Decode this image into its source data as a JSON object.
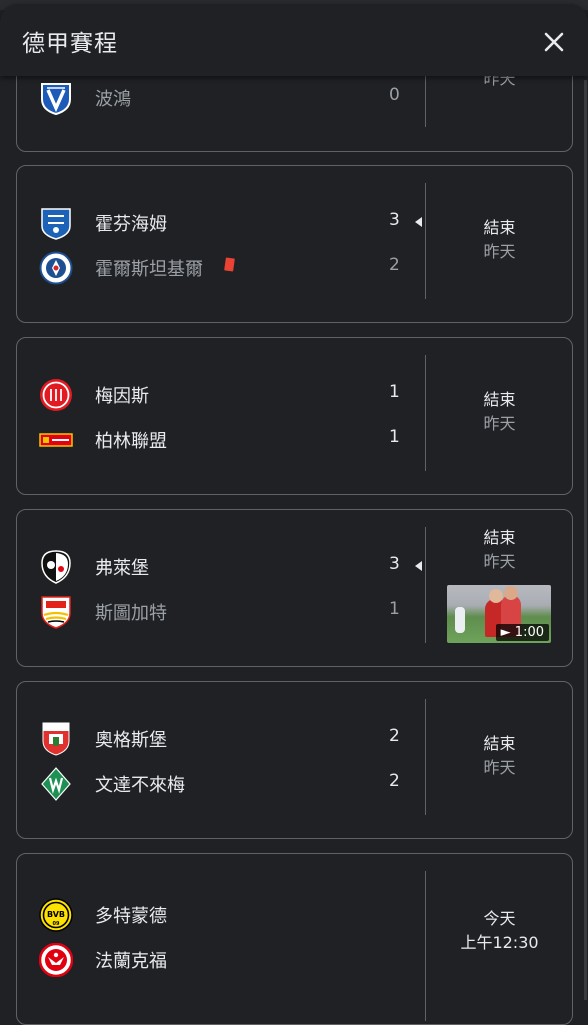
{
  "header": {
    "title": "德甲賽程"
  },
  "matches": [
    {
      "status_line1": "",
      "status_line2": "昨天",
      "home": {
        "name": "",
        "score": "",
        "logo": ""
      },
      "away": {
        "name": "波鴻",
        "score": "0",
        "logo": "bochum-logo"
      }
    },
    {
      "status_line1": "結束",
      "status_line2": "昨天",
      "home": {
        "name": "霍芬海姆",
        "score": "3",
        "logo": "hoffenheim-logo",
        "winner": true
      },
      "away": {
        "name": "霍爾斯坦基爾",
        "score": "2",
        "logo": "holstein-kiel-logo",
        "red_cards": 1
      }
    },
    {
      "status_line1": "結束",
      "status_line2": "昨天",
      "home": {
        "name": "梅因斯",
        "score": "1",
        "logo": "mainz-logo"
      },
      "away": {
        "name": "柏林聯盟",
        "score": "1",
        "logo": "union-berlin-logo"
      }
    },
    {
      "status_line1": "結束",
      "status_line2": "昨天",
      "home": {
        "name": "弗萊堡",
        "score": "3",
        "logo": "freiburg-logo",
        "winner": true
      },
      "away": {
        "name": "斯圖加特",
        "score": "1",
        "logo": "stuttgart-logo"
      },
      "video": {
        "duration": "1:00"
      }
    },
    {
      "status_line1": "結束",
      "status_line2": "昨天",
      "home": {
        "name": "奧格斯堡",
        "score": "2",
        "logo": "augsburg-logo"
      },
      "away": {
        "name": "文達不來梅",
        "score": "2",
        "logo": "werder-bremen-logo"
      }
    },
    {
      "status_line1": "今天",
      "status_line2": "上午12:30",
      "home": {
        "name": "多特蒙德",
        "score": "",
        "logo": "dortmund-logo"
      },
      "away": {
        "name": "法蘭克福",
        "score": "",
        "logo": "frankfurt-logo"
      }
    }
  ],
  "colors": {
    "background": "#202124",
    "card_border": "#5f6368",
    "text_primary": "#e8eaed",
    "text_secondary": "#9aa0a6",
    "red_card": "#ea4335"
  }
}
